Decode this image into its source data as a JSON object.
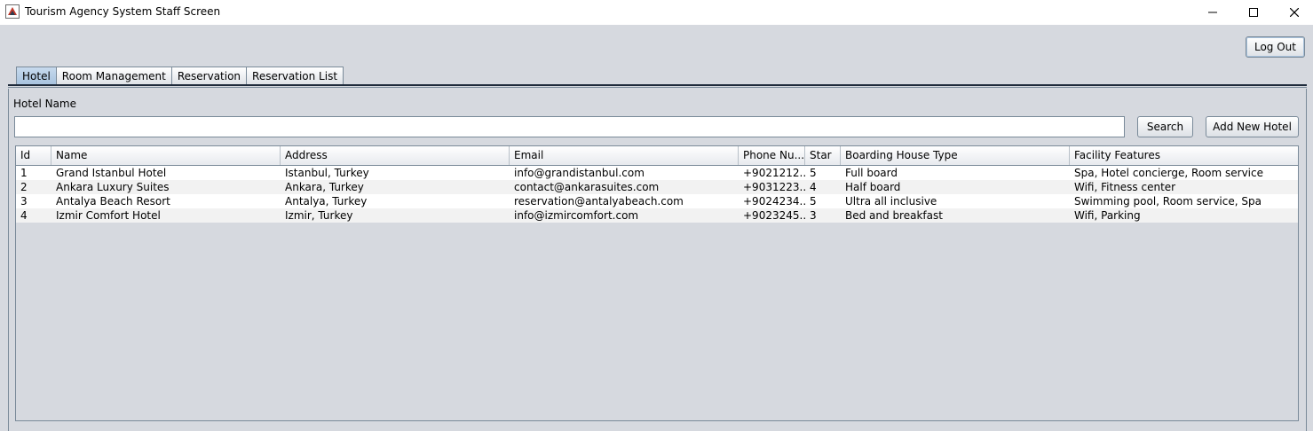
{
  "window": {
    "title": "Tourism Agency System Staff Screen",
    "controls": [
      "minimize-icon",
      "maximize-icon",
      "close-icon"
    ]
  },
  "header": {
    "logout_label": "Log Out"
  },
  "tabs": [
    {
      "label": "Hotel",
      "active": true
    },
    {
      "label": "Room Management",
      "active": false
    },
    {
      "label": "Reservation",
      "active": false
    },
    {
      "label": "Reservation List",
      "active": false
    }
  ],
  "hotel_panel": {
    "hotel_name_label": "Hotel Name",
    "search_value": "",
    "search_label": "Search",
    "add_label": "Add New Hotel"
  },
  "table": {
    "columns": [
      "Id",
      "Name",
      "Address",
      "Email",
      "Phone Nu...",
      "Star",
      "Boarding House Type",
      "Facility Features"
    ],
    "rows": [
      [
        "1",
        "Grand Istanbul Hotel",
        "Istanbul, Turkey",
        "info@grandistanbul.com",
        "+9021212...",
        "5",
        "Full board",
        "Spa, Hotel concierge, Room service"
      ],
      [
        "2",
        "Ankara Luxury Suites",
        "Ankara, Turkey",
        "contact@ankarasuites.com",
        "+9031223...",
        "4",
        "Half board",
        "Wifi, Fitness center"
      ],
      [
        "3",
        "Antalya Beach Resort",
        "Antalya, Turkey",
        "reservation@antalyabeach.com",
        "+9024234...",
        "5",
        "Ultra all inclusive",
        "Swimming pool, Room service, Spa"
      ],
      [
        "4",
        "Izmir Comfort Hotel",
        "Izmir, Turkey",
        "info@izmircomfort.com",
        "+9023245...",
        "3",
        "Bed and breakfast",
        "Wifi, Parking"
      ]
    ]
  },
  "colors": {
    "background": "#d6d9df",
    "active_tab": "#b8cfe6",
    "border": "#7a8a99"
  }
}
